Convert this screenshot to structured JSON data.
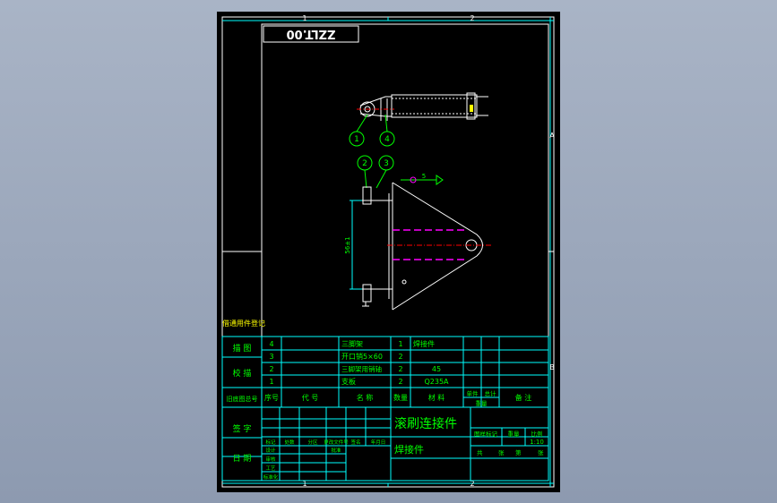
{
  "colors": {
    "background": "#000000",
    "frame": "#ffffff",
    "title_block": "#00ffff",
    "text": "#00ff00",
    "part": "#ffffff",
    "center_line": "#ff0000",
    "hidden_line": "#ff00ff",
    "balloon": "#00ff00",
    "tag": "#ffff00"
  },
  "frame": {
    "zone_top_1": "1",
    "zone_top_2": "2",
    "zone_bottom_1": "1",
    "zone_bottom_2": "2",
    "zone_right_a": "A",
    "zone_right_b": "B"
  },
  "drawing_code_mirrored": "ZZLT.00",
  "views": {
    "top_balloons": [
      "1",
      "4"
    ],
    "front_balloons": [
      "2",
      "3"
    ],
    "dimension": "56±1",
    "weld_symbol": "5"
  },
  "side_labels": {
    "bom_header_tag": "借通用件登记",
    "tracing": "描 图",
    "check": "校 描",
    "old_no": "旧底图总号",
    "sign": "签 字",
    "date": "日 期"
  },
  "bom": {
    "headers": [
      "序号",
      "代  号",
      "名  称",
      "数量",
      "材  料",
      "单件",
      "总计",
      "备  注"
    ],
    "weight_label": "重量",
    "rows": [
      {
        "no": "4",
        "code": "",
        "name": "三脚架",
        "qty": "1",
        "material": "焊接件",
        "note": ""
      },
      {
        "no": "3",
        "code": "",
        "name": "开口销5×60",
        "qty": "2",
        "material": "",
        "note": ""
      },
      {
        "no": "2",
        "code": "",
        "name": "三脚架用销轴",
        "qty": "2",
        "material": "45",
        "note": ""
      },
      {
        "no": "1",
        "code": "",
        "name": "支板",
        "qty": "2",
        "material": "Q235A",
        "note": ""
      }
    ]
  },
  "title_block": {
    "part_name": "滚刷连接件",
    "part_type": "焊接件",
    "stage_label": "图样标记",
    "weight_label": "重量",
    "scale_label": "比例",
    "scale": "1:10",
    "sheet_label": "共",
    "sheet_of": "张",
    "sheet_no_label": "第",
    "sheet_no_suffix": "张",
    "revision_cols": [
      "标记",
      "处数",
      "分区",
      "更改文件号",
      "签名",
      "年月日"
    ],
    "role_labels": [
      "设计",
      "审核",
      "工艺",
      "标准化",
      "批准"
    ]
  }
}
